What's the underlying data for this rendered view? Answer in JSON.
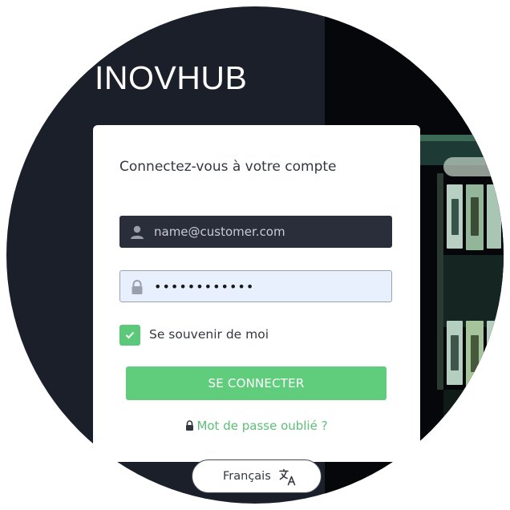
{
  "brand": {
    "name": "INOVHUB"
  },
  "login": {
    "heading": "Connectez-vous à votre compte",
    "email_placeholder": "name@customer.com",
    "password_value": "••••••••••••",
    "remember_label": "Se souvenir de moi",
    "remember_checked": true,
    "submit_label": "SE CONNECTER",
    "forgot_label": "Mot de passe oublié ?"
  },
  "language": {
    "label": "Français"
  },
  "colors": {
    "accent": "#5fcd7c",
    "dark_bg": "#1b1f2a",
    "input_dark": "#2a2d3a",
    "input_autofill": "#e8f0fe"
  },
  "icons": {
    "email": "user-icon",
    "password": "lock-icon",
    "remember": "checkmark-icon",
    "forgot": "lock-icon",
    "language": "translate-icon"
  }
}
